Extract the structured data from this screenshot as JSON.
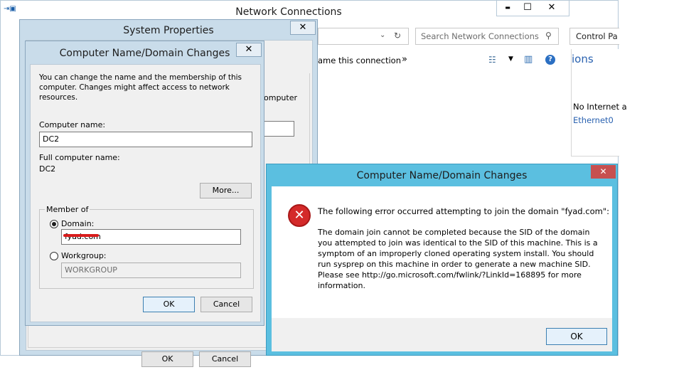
{
  "network_window": {
    "title": "Network Connections",
    "min": "▬",
    "max": "☐",
    "close": "✕",
    "search_placeholder": "Search Network Connections",
    "rename_label": "ame this connection",
    "more_chevron": "»",
    "control_panel": "Control Pa",
    "side_heading": "ions",
    "no_internet": "No Internet a",
    "ethernet": "Ethernet0"
  },
  "system_properties": {
    "title": "System Properties",
    "close": "✕",
    "peek_text": "omputer",
    "ok": "OK",
    "cancel": "Cancel"
  },
  "name_changes": {
    "title": "Computer Name/Domain Changes",
    "close": "✕",
    "intro": "You can change the name and the membership of this computer. Changes might affect access to network resources.",
    "computer_name_label": "Computer name:",
    "computer_name_value": "DC2",
    "full_name_label": "Full computer name:",
    "full_name_value": "DC2",
    "more_button": "More...",
    "member_of_label": "Member of",
    "domain_label": "Domain:",
    "domain_value": "fyad.com",
    "workgroup_label": "Workgroup:",
    "workgroup_value": "WORKGROUP",
    "ok": "OK",
    "cancel": "Cancel"
  },
  "error_dialog": {
    "title": "Computer Name/Domain Changes",
    "close": "✕",
    "headline": "The following error occurred attempting to join the domain \"fyad.com\":",
    "body_lines": [
      "The domain join cannot be completed because the SID of the domain",
      "you attempted to join was identical to the SID of this machine. This is a",
      "symptom of an improperly cloned operating system install.  You should",
      "run sysprep on this machine in order to generate a new machine SID.",
      "Please see http://go.microsoft.com/fwlink/?LinkId=168895 for more",
      "information."
    ],
    "ok": "OK"
  },
  "colors": {
    "dialog_blue": "#c9dcea",
    "error_frame": "#5bbfe0",
    "close_red": "#c75050",
    "error_icon": "#d42a2a"
  }
}
